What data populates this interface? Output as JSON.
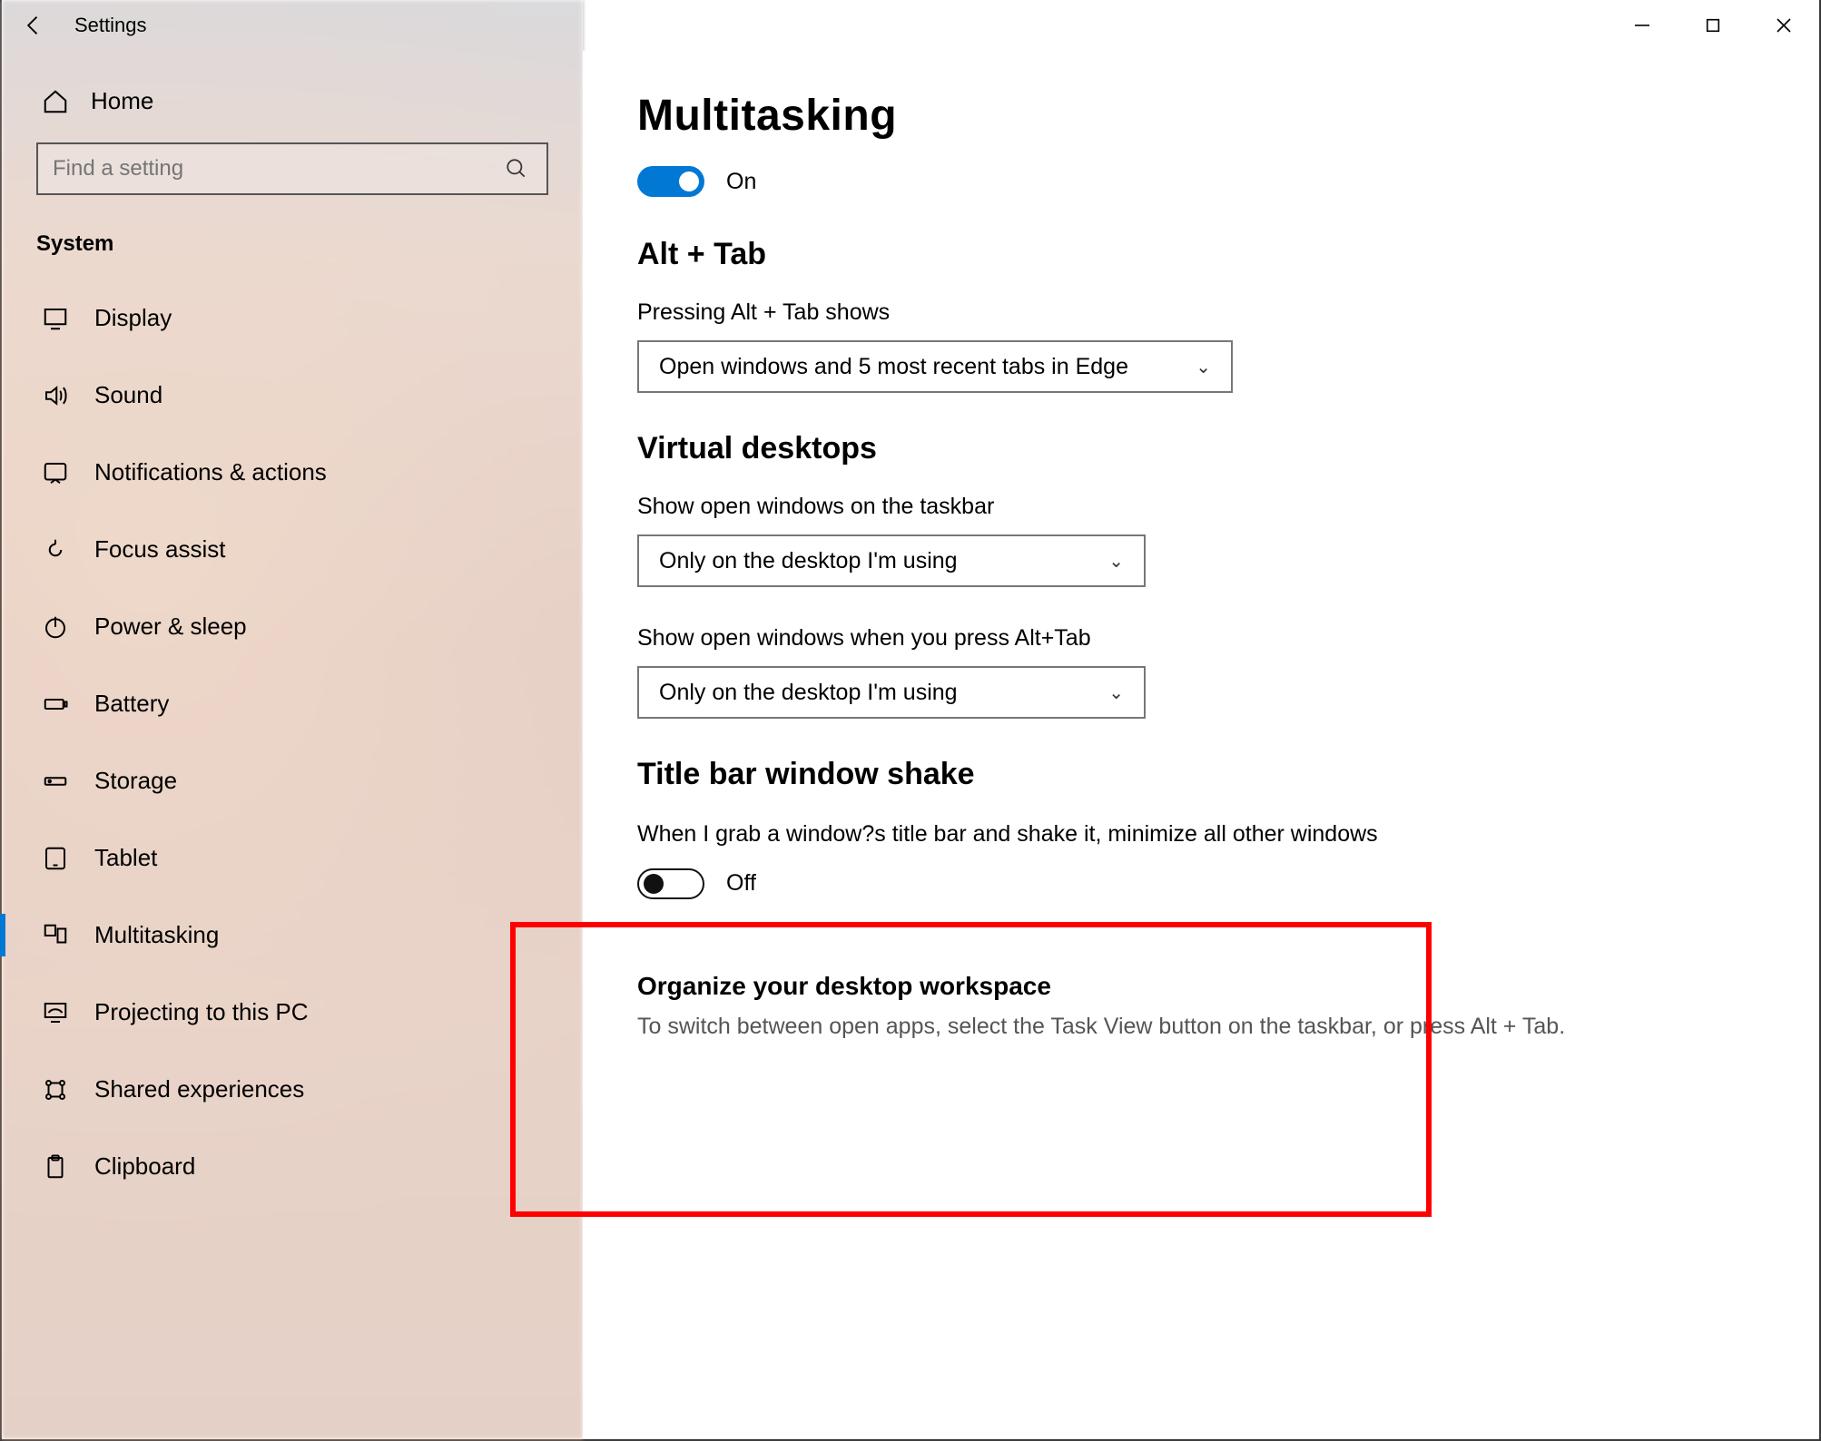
{
  "window": {
    "title": "Settings"
  },
  "sidebar": {
    "home": "Home",
    "search_placeholder": "Find a setting",
    "category": "System",
    "items": [
      {
        "label": "Display"
      },
      {
        "label": "Sound"
      },
      {
        "label": "Notifications & actions"
      },
      {
        "label": "Focus assist"
      },
      {
        "label": "Power & sleep"
      },
      {
        "label": "Battery"
      },
      {
        "label": "Storage"
      },
      {
        "label": "Tablet"
      },
      {
        "label": "Multitasking"
      },
      {
        "label": "Projecting to this PC"
      },
      {
        "label": "Shared experiences"
      },
      {
        "label": "Clipboard"
      }
    ]
  },
  "main": {
    "title": "Multitasking",
    "master_toggle": {
      "state": "On"
    },
    "alttab": {
      "heading": "Alt + Tab",
      "label": "Pressing Alt + Tab shows",
      "value": "Open windows and 5 most recent tabs in Edge"
    },
    "vdesktops": {
      "heading": "Virtual desktops",
      "taskbar_label": "Show open windows on the taskbar",
      "taskbar_value": "Only on the desktop I'm using",
      "alttab_label": "Show open windows when you press Alt+Tab",
      "alttab_value": "Only on the desktop I'm using"
    },
    "shake": {
      "heading": "Title bar window shake",
      "desc": "When I grab a window?s title bar and shake it, minimize all other windows",
      "state": "Off"
    },
    "workspace": {
      "heading": "Organize your desktop workspace",
      "sub": "To switch between open apps, select the Task View button on the taskbar, or press Alt + Tab."
    }
  }
}
